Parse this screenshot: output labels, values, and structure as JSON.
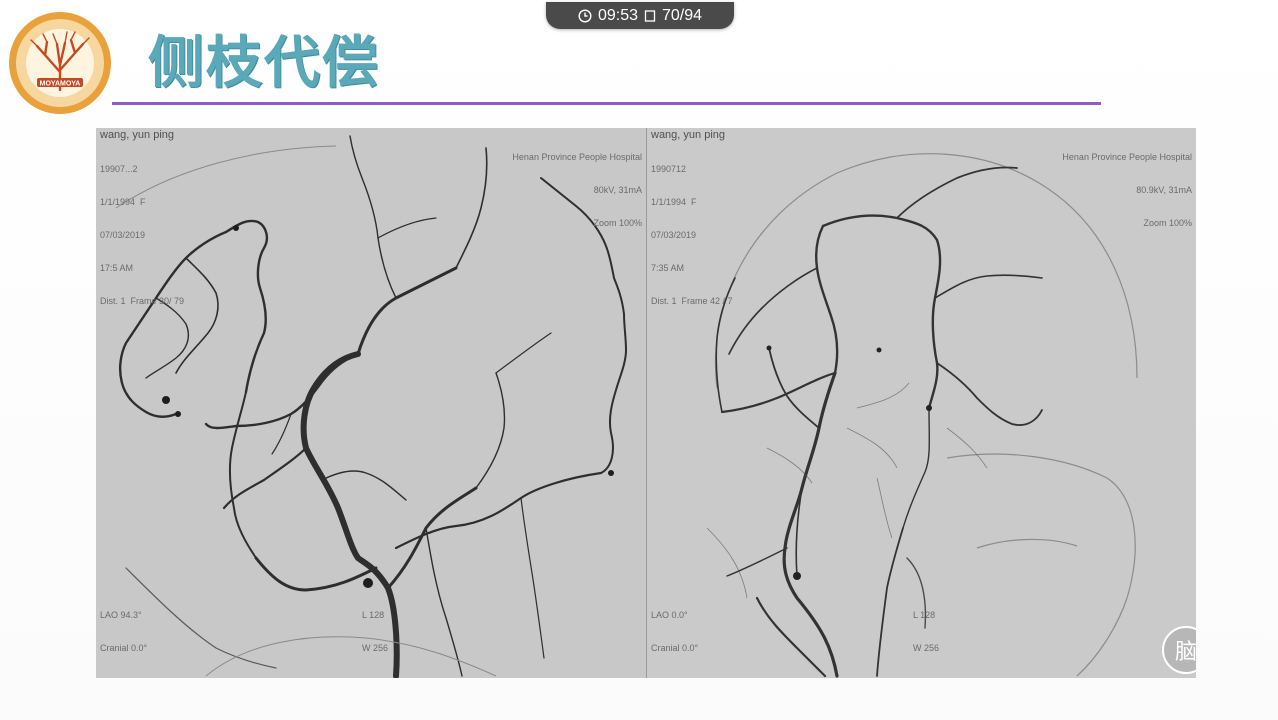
{
  "status_bar": {
    "time": "09:53",
    "page_counter": "70/94"
  },
  "slide": {
    "title": "侧枝代偿",
    "logo_text": "MOYAMOYA"
  },
  "images": {
    "left": {
      "patient_name": "wang, yun ping",
      "info_lines": [
        "19907...2",
        "1/1/1994  F",
        "07/03/2019",
        "17:5 AM",
        "Dist. 1  Frame 30/ 79"
      ],
      "hospital": "Henan Province People Hospital",
      "params": [
        "80kV, 31mA",
        "Zoom 100%"
      ],
      "angle": "LAO 94.3°",
      "cranial": "Cranial 0.0°",
      "series_info": "L 128",
      "window": "W 256"
    },
    "right": {
      "patient_name": "wang, yun ping",
      "info_lines": [
        "1990712",
        "1/1/1994  F",
        "07/03/2019",
        "7:35 AM",
        "Dist. 1  Frame 42 / 7"
      ],
      "hospital": "Henan Province People Hospital",
      "params": [
        "80.9kV, 31mA",
        "Zoom 100%"
      ],
      "angle": "LAO 0.0°",
      "cranial": "Cranial 0.0°",
      "series_info": "L 128",
      "window": "W 256",
      "watermark_glyph": "脑"
    }
  },
  "colors": {
    "title": "#5aa8b8",
    "divider": "#8e5cc4",
    "status_pill": "#4a4a4a",
    "vessel": "#2a2a2a"
  },
  "icons": [
    "clock-icon",
    "page-icon",
    "logo-tree-icon"
  ]
}
